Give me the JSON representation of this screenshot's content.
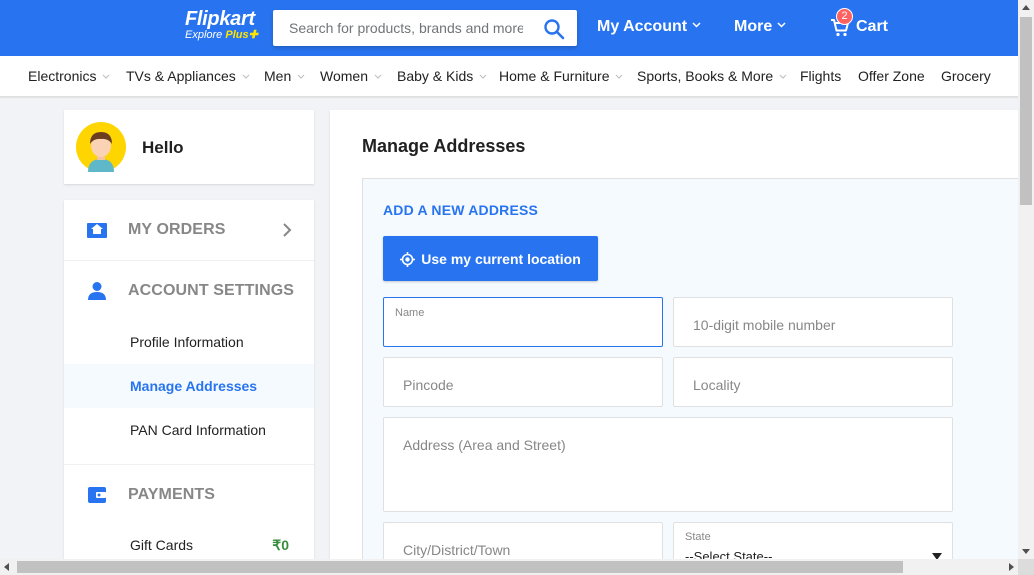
{
  "header": {
    "logo_main": "Flipkart",
    "logo_sub": "Explore",
    "logo_plus": "Plus",
    "search_placeholder": "Search for products, brands and more",
    "my_account": "My Account",
    "more": "More",
    "cart_label": "Cart",
    "cart_count": "2",
    "colors": {
      "brand": "#2874f0",
      "plus": "#ffe500",
      "badge": "#ff6161"
    }
  },
  "categories": [
    {
      "label": "Electronics",
      "has_dropdown": true
    },
    {
      "label": "TVs & Appliances",
      "has_dropdown": true
    },
    {
      "label": "Men",
      "has_dropdown": true
    },
    {
      "label": "Women",
      "has_dropdown": true
    },
    {
      "label": "Baby & Kids",
      "has_dropdown": true
    },
    {
      "label": "Home & Furniture",
      "has_dropdown": true
    },
    {
      "label": "Sports, Books & More",
      "has_dropdown": true
    },
    {
      "label": "Flights",
      "has_dropdown": false
    },
    {
      "label": "Offer Zone",
      "has_dropdown": false
    },
    {
      "label": "Grocery",
      "has_dropdown": false
    }
  ],
  "sidebar": {
    "hello": "Hello",
    "my_orders": "MY ORDERS",
    "account_settings": "ACCOUNT SETTINGS",
    "account_items": [
      "Profile Information",
      "Manage Addresses",
      "PAN Card Information"
    ],
    "active_item": "Manage Addresses",
    "payments": "PAYMENTS",
    "gift_cards": "Gift Cards",
    "gift_cards_amount": "₹0"
  },
  "main": {
    "title": "Manage Addresses",
    "add_new": "ADD A NEW ADDRESS",
    "use_location": "Use my current location",
    "fields": {
      "name_label": "Name",
      "mobile_placeholder": "10-digit mobile number",
      "pincode_placeholder": "Pincode",
      "locality_placeholder": "Locality",
      "address_placeholder": "Address (Area and Street)",
      "city_placeholder": "City/District/Town",
      "state_label": "State",
      "state_value": "--Select State--"
    }
  }
}
